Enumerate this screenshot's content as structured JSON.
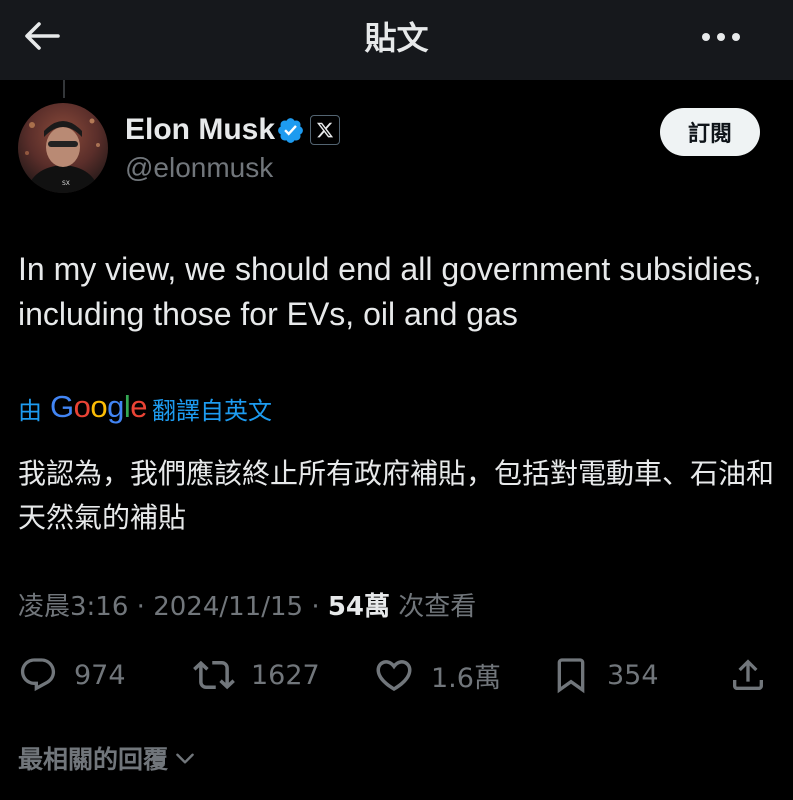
{
  "header": {
    "title": "貼文",
    "back_icon": "arrow-left-icon",
    "more_icon": "more-horizontal-icon"
  },
  "author": {
    "name": "Elon Musk",
    "handle": "@elonmusk",
    "verified": true,
    "affiliation_icon": "x-logo-icon",
    "subscribe_label": "訂閱"
  },
  "tweet": {
    "text": "In my view, we should end all government subsidies, including those for EVs, oil and gas",
    "translation_prefix": "由",
    "translation_source": "Google",
    "translation_suffix": "翻譯自英文",
    "translated_text": "我認為，我們應該終止所有政府補貼，包括對電動車、石油和天然氣的補貼",
    "time": "凌晨3:16",
    "date": "2024/11/15",
    "views_count": "54萬",
    "views_label": "次查看",
    "separator": "·"
  },
  "actions": {
    "replies": "974",
    "reposts": "1627",
    "likes": "1.6萬",
    "bookmarks": "354"
  },
  "replies_sort": {
    "label": "最相關的回覆"
  },
  "colors": {
    "background": "#000000",
    "header_background": "#16181c",
    "text_primary": "#e7e9ea",
    "text_secondary": "#71767b",
    "accent_blue": "#1d9bf0",
    "button_background": "#eff3f4"
  }
}
